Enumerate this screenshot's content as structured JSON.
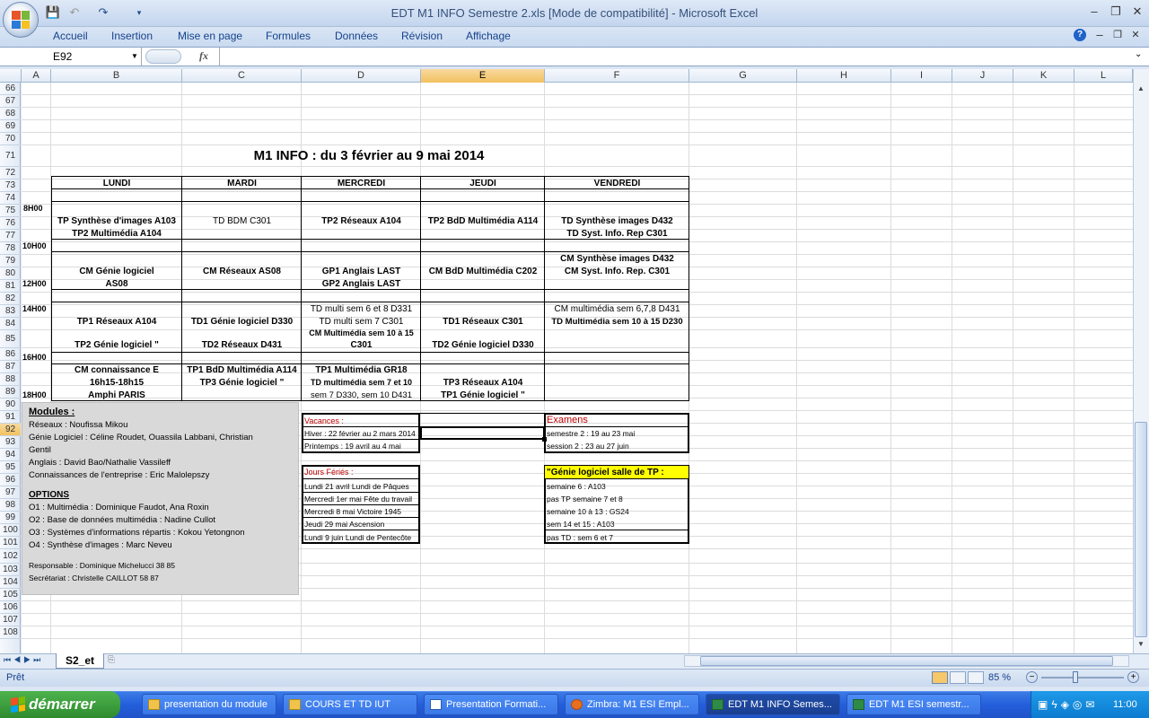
{
  "window": {
    "title": "EDT M1 INFO Semestre 2.xls  [Mode de compatibilité] - Microsoft Excel",
    "min": "–",
    "max": "❐",
    "close": "✕",
    "doc_min": "–",
    "doc_max": "❐",
    "doc_close": "✕"
  },
  "ribbon": {
    "tabs": [
      "Accueil",
      "Insertion",
      "Mise en page",
      "Formules",
      "Données",
      "Révision",
      "Affichage"
    ],
    "help": "?"
  },
  "formula_bar": {
    "name_box": "E92",
    "fx": "fx",
    "value": ""
  },
  "columns": [
    "A",
    "B",
    "C",
    "D",
    "E",
    "F",
    "G",
    "H",
    "I",
    "J",
    "K",
    "L"
  ],
  "rows": [
    "66",
    "67",
    "68",
    "69",
    "70",
    "71",
    "72",
    "73",
    "74",
    "75",
    "76",
    "77",
    "78",
    "79",
    "80",
    "81",
    "82",
    "83",
    "84",
    "85",
    "86",
    "87",
    "88",
    "89",
    "90",
    "91",
    "92",
    "93",
    "94",
    "95",
    "96",
    "97",
    "98",
    "99",
    "100",
    "101",
    "102",
    "103",
    "104",
    "105",
    "106",
    "107",
    "108"
  ],
  "selected": {
    "column": "E",
    "row": "92"
  },
  "sheet": {
    "title": "M1 INFO : du 3 février au 9 mai 2014",
    "days": [
      "LUNDI",
      "MARDI",
      "MERCREDI",
      "JEUDI",
      "VENDREDI"
    ],
    "times": {
      "t8": "8H00",
      "t10": "10H00",
      "t12": "12H00",
      "t14": "14H00",
      "t16": "16H00",
      "t18": "18H00"
    },
    "slot1": {
      "lundi1": "TP Synthèse d'images A103",
      "lundi2": "TP2 Multimédia  A104",
      "mardi": "TD BDM C301",
      "mercredi": "TP2 Réseaux  A104",
      "jeudi": "TP2 BdD Multimédia A114",
      "vendredi1": "TD Synthèse images D432",
      "vendredi2": "TD Syst. Info. Rep C301"
    },
    "slot2": {
      "lundi1": "CM Génie logiciel",
      "lundi2": "AS08",
      "mardi": "CM Réseaux AS08",
      "mercredi1": "GP1 Anglais LAST",
      "mercredi2": "GP2 Anglais LAST",
      "jeudi": "CM BdD Multimédia C202",
      "vendredi1": "CM Synthèse images  D432",
      "vendredi2": "CM Syst. Info. Rep. C301"
    },
    "slot3": {
      "lundi1": "TP1 Réseaux A104",
      "lundi2": "TP2 Génie logiciel  \"",
      "mardi1": "TD1 Génie logiciel   D330",
      "mardi2": "TD2 Réseaux D431",
      "mercredi1": "TD multi sem 6 et 8 D331",
      "mercredi2": "TD multi sem 7 C301",
      "mercredi3": "CM Multimédia sem 10 à 15",
      "mercredi4": "C301",
      "jeudi1": "TD1 Réseaux C301",
      "jeudi2": "TD2 Génie logiciel   D330",
      "vendredi1": "CM multimédia sem 6,7,8 D431",
      "vendredi2": "TD Multimédia   sem 10 à 15 D230"
    },
    "slot4": {
      "lundi1": "CM connaissance E",
      "lundi2": "16h15-18h15",
      "lundi3": "Amphi PARIS",
      "mardi1": "TP1 BdD Multimédia A114",
      "mardi2": "TP3 Génie logiciel  \"",
      "mercredi1": "TP1 Multimédia  GR18",
      "mercredi2": "TD multimédia sem 7 et 10",
      "mercredi3": "sem 7 D330, sem 10 D431",
      "jeudi1": "TP3 Réseaux A104",
      "jeudi2": "TP1 Génie logiciel \""
    },
    "modules": {
      "heading": "Modules :",
      "lines": [
        "Réseaux : Noufissa  Mikou",
        "Génie Logiciel : Céline Roudet, Ouassila Labbani, Christian",
        "Gentil",
        "Anglais : David Bao/Nathalie  Vassileff",
        "Connaissances de l'entreprise : Eric Malolepszy"
      ],
      "options_heading": "OPTIONS",
      "options": [
        "O1 : Multimédia : Dominique Faudot, Ana Roxin",
        "O2 : Base de données multimédia : Nadine Cullot",
        "O3 : Systèmes d'informations répartis : Kokou Yetongnon",
        "O4 : Synthèse d'images : Marc Neveu"
      ],
      "responsable": "Responsable : Dominique  Michelucci  38 85",
      "secretariat": "Secrétariat : Christelle  CAILLOT 58 87"
    },
    "vacances": {
      "heading": "Vacances :",
      "lines": [
        "Hiver : 22 février au 2 mars 2014",
        "Printemps : 19 avril au 4 mai"
      ]
    },
    "feries": {
      "heading": "Jours Fériés :",
      "lines": [
        "Lundi 21 avril Lundi de Pâques",
        "Mercredi 1er mai Fête du travail",
        "Mercredi 8 mai Victoire 1945",
        "Jeudi 29 mai Ascension",
        "Lundi 9 juin Lundi de Pentecôte"
      ]
    },
    "examens": {
      "heading": "Examens",
      "lines": [
        "semestre 2 : 19 au 23 mai",
        "session 2 : 23 au 27 juin"
      ]
    },
    "genie": {
      "heading": "\"Génie logiciel salle de TP :",
      "lines": [
        "semaine 6 : A103",
        "pas TP semaine 7 et 8",
        "semaine 10 à 13 : GS24",
        "sem 14 et 15 : A103",
        "pas TD : sem 6 et 7"
      ]
    }
  },
  "sheet_tab": "S2_et",
  "status": {
    "ready": "Prêt",
    "zoom": "85 %"
  },
  "taskbar": {
    "start": "démarrer",
    "items": [
      "presentation du module",
      "COURS ET TD IUT",
      "Presentation Formati...",
      "Zimbra: M1 ESI Empl...",
      "EDT M1 INFO Semes...",
      "EDT M1 ESI semestr..."
    ],
    "clock": "11:00"
  },
  "colors": {
    "accent": "#15428b",
    "title_red": "#c00000",
    "highlight_yellow": "#ffff00",
    "selection": "#f1c15f"
  }
}
